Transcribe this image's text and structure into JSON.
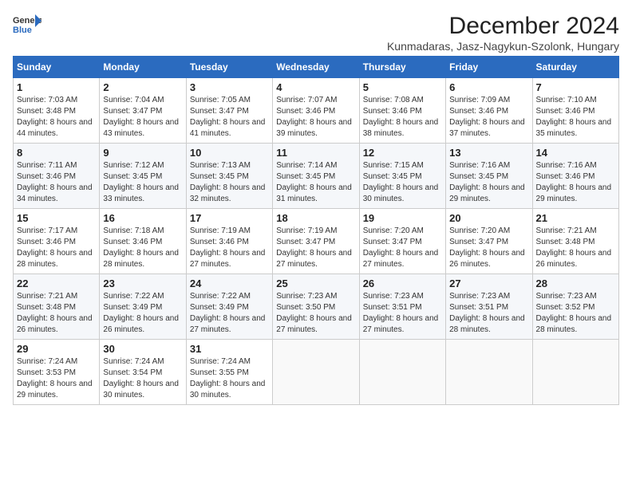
{
  "header": {
    "logo_line1": "General",
    "logo_line2": "Blue",
    "main_title": "December 2024",
    "subtitle": "Kunmadaras, Jasz-Nagykun-Szolonk, Hungary"
  },
  "weekdays": [
    "Sunday",
    "Monday",
    "Tuesday",
    "Wednesday",
    "Thursday",
    "Friday",
    "Saturday"
  ],
  "days": [
    {
      "day": "",
      "info": ""
    },
    {
      "day": "",
      "info": ""
    },
    {
      "day": "",
      "info": ""
    },
    {
      "day": "",
      "info": ""
    },
    {
      "day": "",
      "info": ""
    },
    {
      "day": "",
      "info": ""
    },
    {
      "day": "1",
      "info": "Sunrise: 7:03 AM\nSunset: 3:48 PM\nDaylight: 8 hours and 44 minutes."
    },
    {
      "day": "2",
      "info": "Sunrise: 7:04 AM\nSunset: 3:47 PM\nDaylight: 8 hours and 43 minutes."
    },
    {
      "day": "3",
      "info": "Sunrise: 7:05 AM\nSunset: 3:47 PM\nDaylight: 8 hours and 41 minutes."
    },
    {
      "day": "4",
      "info": "Sunrise: 7:07 AM\nSunset: 3:46 PM\nDaylight: 8 hours and 39 minutes."
    },
    {
      "day": "5",
      "info": "Sunrise: 7:08 AM\nSunset: 3:46 PM\nDaylight: 8 hours and 38 minutes."
    },
    {
      "day": "6",
      "info": "Sunrise: 7:09 AM\nSunset: 3:46 PM\nDaylight: 8 hours and 37 minutes."
    },
    {
      "day": "7",
      "info": "Sunrise: 7:10 AM\nSunset: 3:46 PM\nDaylight: 8 hours and 35 minutes."
    },
    {
      "day": "8",
      "info": "Sunrise: 7:11 AM\nSunset: 3:46 PM\nDaylight: 8 hours and 34 minutes."
    },
    {
      "day": "9",
      "info": "Sunrise: 7:12 AM\nSunset: 3:45 PM\nDaylight: 8 hours and 33 minutes."
    },
    {
      "day": "10",
      "info": "Sunrise: 7:13 AM\nSunset: 3:45 PM\nDaylight: 8 hours and 32 minutes."
    },
    {
      "day": "11",
      "info": "Sunrise: 7:14 AM\nSunset: 3:45 PM\nDaylight: 8 hours and 31 minutes."
    },
    {
      "day": "12",
      "info": "Sunrise: 7:15 AM\nSunset: 3:45 PM\nDaylight: 8 hours and 30 minutes."
    },
    {
      "day": "13",
      "info": "Sunrise: 7:16 AM\nSunset: 3:45 PM\nDaylight: 8 hours and 29 minutes."
    },
    {
      "day": "14",
      "info": "Sunrise: 7:16 AM\nSunset: 3:46 PM\nDaylight: 8 hours and 29 minutes."
    },
    {
      "day": "15",
      "info": "Sunrise: 7:17 AM\nSunset: 3:46 PM\nDaylight: 8 hours and 28 minutes."
    },
    {
      "day": "16",
      "info": "Sunrise: 7:18 AM\nSunset: 3:46 PM\nDaylight: 8 hours and 28 minutes."
    },
    {
      "day": "17",
      "info": "Sunrise: 7:19 AM\nSunset: 3:46 PM\nDaylight: 8 hours and 27 minutes."
    },
    {
      "day": "18",
      "info": "Sunrise: 7:19 AM\nSunset: 3:47 PM\nDaylight: 8 hours and 27 minutes."
    },
    {
      "day": "19",
      "info": "Sunrise: 7:20 AM\nSunset: 3:47 PM\nDaylight: 8 hours and 27 minutes."
    },
    {
      "day": "20",
      "info": "Sunrise: 7:20 AM\nSunset: 3:47 PM\nDaylight: 8 hours and 26 minutes."
    },
    {
      "day": "21",
      "info": "Sunrise: 7:21 AM\nSunset: 3:48 PM\nDaylight: 8 hours and 26 minutes."
    },
    {
      "day": "22",
      "info": "Sunrise: 7:21 AM\nSunset: 3:48 PM\nDaylight: 8 hours and 26 minutes."
    },
    {
      "day": "23",
      "info": "Sunrise: 7:22 AM\nSunset: 3:49 PM\nDaylight: 8 hours and 26 minutes."
    },
    {
      "day": "24",
      "info": "Sunrise: 7:22 AM\nSunset: 3:49 PM\nDaylight: 8 hours and 27 minutes."
    },
    {
      "day": "25",
      "info": "Sunrise: 7:23 AM\nSunset: 3:50 PM\nDaylight: 8 hours and 27 minutes."
    },
    {
      "day": "26",
      "info": "Sunrise: 7:23 AM\nSunset: 3:51 PM\nDaylight: 8 hours and 27 minutes."
    },
    {
      "day": "27",
      "info": "Sunrise: 7:23 AM\nSunset: 3:51 PM\nDaylight: 8 hours and 28 minutes."
    },
    {
      "day": "28",
      "info": "Sunrise: 7:23 AM\nSunset: 3:52 PM\nDaylight: 8 hours and 28 minutes."
    },
    {
      "day": "29",
      "info": "Sunrise: 7:24 AM\nSunset: 3:53 PM\nDaylight: 8 hours and 29 minutes."
    },
    {
      "day": "30",
      "info": "Sunrise: 7:24 AM\nSunset: 3:54 PM\nDaylight: 8 hours and 30 minutes."
    },
    {
      "day": "31",
      "info": "Sunrise: 7:24 AM\nSunset: 3:55 PM\nDaylight: 8 hours and 30 minutes."
    },
    {
      "day": "",
      "info": ""
    },
    {
      "day": "",
      "info": ""
    },
    {
      "day": "",
      "info": ""
    },
    {
      "day": "",
      "info": ""
    },
    {
      "day": "",
      "info": ""
    }
  ]
}
